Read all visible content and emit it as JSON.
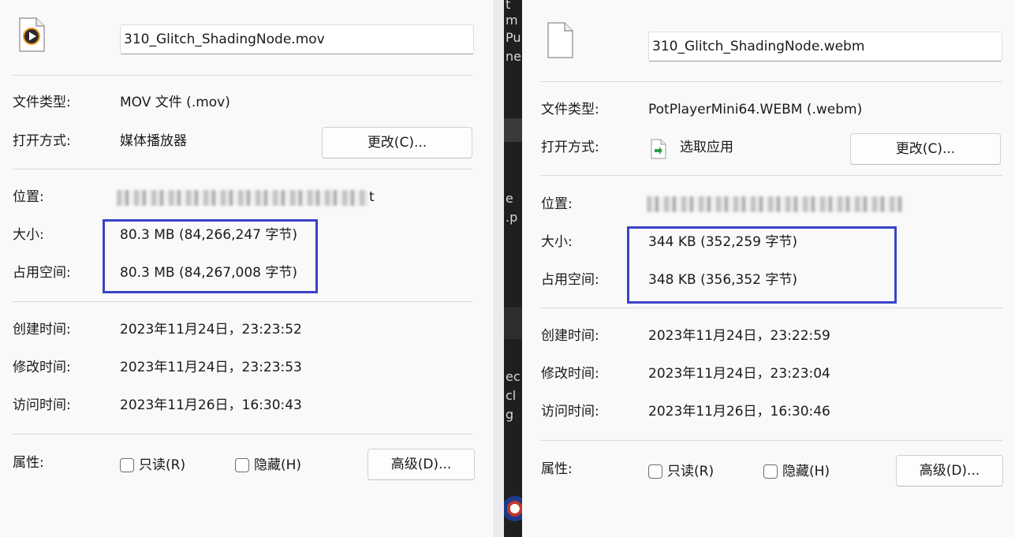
{
  "left": {
    "filename": "310_Glitch_ShadingNode.mov",
    "file_type_label": "文件类型:",
    "file_type_value": "MOV 文件 (.mov)",
    "open_with_label": "打开方式:",
    "open_with_value": "媒体播放器",
    "change_button": "更改(C)...",
    "location_label": "位置:",
    "location_tail": "t",
    "size_label": "大小:",
    "size_value": "80.3 MB (84,266,247 字节)",
    "size_on_disk_label": "占用空间:",
    "size_on_disk_value": "80.3 MB (84,267,008 字节)",
    "created_label": "创建时间:",
    "created_value": "2023年11月24日，23:23:52",
    "modified_label": "修改时间:",
    "modified_value": "2023年11月24日，23:23:53",
    "accessed_label": "访问时间:",
    "accessed_value": "2023年11月26日，16:30:43",
    "attributes_label": "属性:",
    "readonly_label": "只读(R)",
    "hidden_label": "隐藏(H)",
    "advanced_button": "高级(D)..."
  },
  "right": {
    "filename": "310_Glitch_ShadingNode.webm",
    "file_type_label": "文件类型:",
    "file_type_value": "PotPlayerMini64.WEBM (.webm)",
    "open_with_label": "打开方式:",
    "open_with_value": "选取应用",
    "change_button": "更改(C)...",
    "location_label": "位置:",
    "size_label": "大小:",
    "size_value": "344 KB (352,259 字节)",
    "size_on_disk_label": "占用空间:",
    "size_on_disk_value": "348 KB (356,352 字节)",
    "created_label": "创建时间:",
    "created_value": "2023年11月24日，23:22:59",
    "modified_label": "修改时间:",
    "modified_value": "2023年11月24日，23:23:04",
    "accessed_label": "访问时间:",
    "accessed_value": "2023年11月26日，16:30:46",
    "attributes_label": "属性:",
    "readonly_label": "只读(R)",
    "hidden_label": "隐藏(H)",
    "advanced_button": "高级(D)..."
  },
  "background_fragments": [
    "t",
    "m",
    "Pu",
    "ne",
    "e",
    ".p",
    "ec",
    "cl",
    "g"
  ],
  "colors": {
    "highlight_border": "#3a43c8",
    "panel_bg": "#f9f9f9",
    "divider": "#d9d9d9"
  },
  "icons": {
    "left_file_icon": "video-file-icon",
    "right_file_icon": "blank-file-icon",
    "open_with_icon": "choose-app-icon"
  }
}
